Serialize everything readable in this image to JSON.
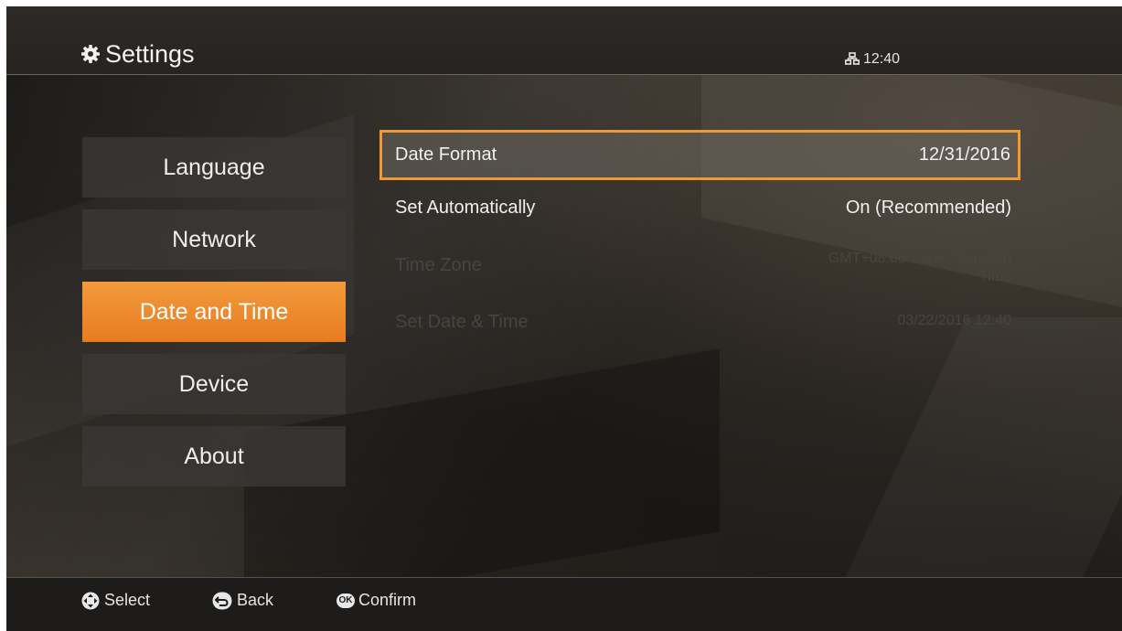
{
  "header": {
    "title": "Settings",
    "time": "12:40",
    "settings_icon": "gear-icon",
    "network_icon": "network-icon"
  },
  "sidebar": {
    "items": [
      {
        "label": "Language",
        "active": false
      },
      {
        "label": "Network",
        "active": false
      },
      {
        "label": "Date and Time",
        "active": true
      },
      {
        "label": "Device",
        "active": false
      },
      {
        "label": "About",
        "active": false
      }
    ]
  },
  "main": {
    "rows": [
      {
        "label": "Date Format",
        "value": "12/31/2016",
        "state": "selected"
      },
      {
        "label": "Set Automatically",
        "value": "On (Recommended)",
        "state": "normal"
      },
      {
        "label": "Time Zone",
        "value_line1": "GMT+08:00 Taipei Standard",
        "value_line2": "Time",
        "state": "disabled"
      },
      {
        "label": "Set Date & Time",
        "value": "03/22/2016 12:40",
        "state": "disabled"
      }
    ]
  },
  "footer": {
    "select_label": "Select",
    "back_label": "Back",
    "ok_badge": "OK",
    "confirm_label": "Confirm"
  },
  "colors": {
    "accent": "#f0992e",
    "active_item": "#e67c20"
  }
}
